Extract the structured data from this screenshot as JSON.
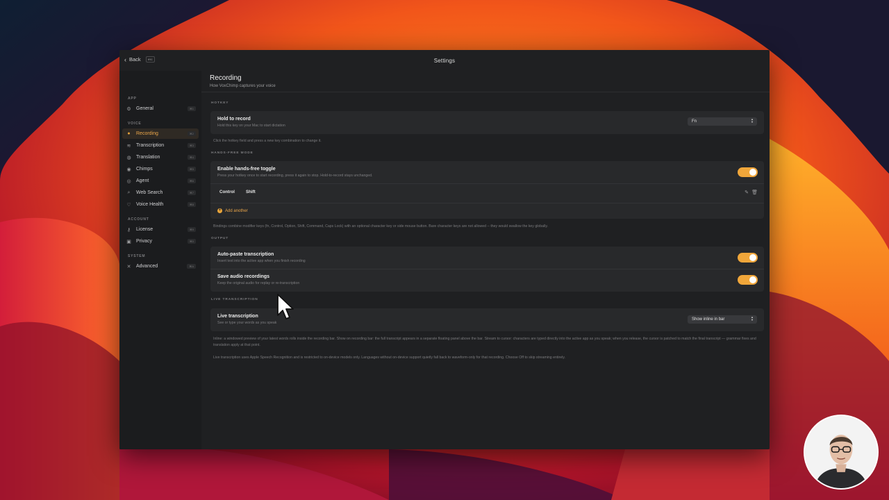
{
  "window": {
    "title": "Settings",
    "back_label": "Back",
    "back_kbd": "esc"
  },
  "sidebar": {
    "groups": [
      {
        "label": "APP"
      },
      {
        "label": "VOICE"
      },
      {
        "label": "ACCOUNT"
      },
      {
        "label": "SYSTEM"
      }
    ],
    "items": [
      {
        "label": "General",
        "shortcut": "⌘1",
        "icon": "gear-icon",
        "active": false
      },
      {
        "label": "Recording",
        "shortcut": "⌘2",
        "icon": "microphone-icon",
        "active": true
      },
      {
        "label": "Transcription",
        "shortcut": "⌘3",
        "icon": "waveform-icon",
        "active": false
      },
      {
        "label": "Translation",
        "shortcut": "⌘4",
        "icon": "globe-icon",
        "active": false
      },
      {
        "label": "Chimps",
        "shortcut": "⌘5",
        "icon": "chimp-icon",
        "active": false
      },
      {
        "label": "Agent",
        "shortcut": "⌘6",
        "icon": "agent-icon",
        "active": false
      },
      {
        "label": "Web Search",
        "shortcut": "⌘7",
        "icon": "search-icon",
        "active": false
      },
      {
        "label": "Voice Health",
        "shortcut": "⌘8",
        "icon": "heart-icon",
        "active": false
      },
      {
        "label": "License",
        "shortcut": "⌘9",
        "icon": "key-icon",
        "active": false
      },
      {
        "label": "Privacy",
        "shortcut": "⌘0",
        "icon": "lock-icon",
        "active": false
      },
      {
        "label": "Advanced",
        "shortcut": "⌘A",
        "icon": "tools-icon",
        "active": false
      }
    ]
  },
  "page": {
    "title": "Recording",
    "subtitle": "How VoxChimp captures your voice"
  },
  "hotkey": {
    "section": "HOTKEY",
    "title": "Hold to record",
    "desc": "Hold this key on your Mac to start dictation",
    "value": "Fn",
    "help": "Click the hotkey field and press a new key combination to change it."
  },
  "handsfree": {
    "section": "HANDS-FREE MODE",
    "title": "Enable hands-free toggle",
    "desc": "Press your hotkey once to start recording, press it again to stop. Hold-to-record stays unchanged.",
    "enabled": true,
    "binding_keys": [
      "Control",
      "Shift"
    ],
    "add_label": "Add another",
    "help": "Bindings combine modifier keys (fn, Control, Option, Shift, Command, Caps Lock) with an optional character key or side mouse button. Bare character keys are not allowed -- they would swallow the key globally."
  },
  "output": {
    "section": "OUTPUT",
    "autopaste_title": "Auto-paste transcription",
    "autopaste_desc": "Insert text into the active app when you finish recording",
    "autopaste_enabled": true,
    "save_title": "Save audio recordings",
    "save_desc": "Keep the original audio for replay or re-transcription",
    "save_enabled": true
  },
  "live": {
    "section": "LIVE TRANSCRIPTION",
    "title": "Live transcription",
    "desc": "See or type your words as you speak",
    "value": "Show inline in bar",
    "help1": "Inline: a windowed preview of your latest words rolls inside the recording bar. Show on recording bar: the full transcript appears in a separate floating panel above the bar. Stream to cursor: characters are typed directly into the active app as you speak; when you release, the cursor is patched to match the final transcript — grammar fixes and translation apply at that point.",
    "help2": "Live transcription uses Apple Speech Recognition and is restricted to on-device models only. Languages without on-device support quietly fall back to waveform-only for that recording. Choose Off to skip streaming entirely."
  },
  "colors": {
    "accent": "#f0a63a",
    "window_bg": "#1f2022",
    "card_bg": "#28292b"
  }
}
